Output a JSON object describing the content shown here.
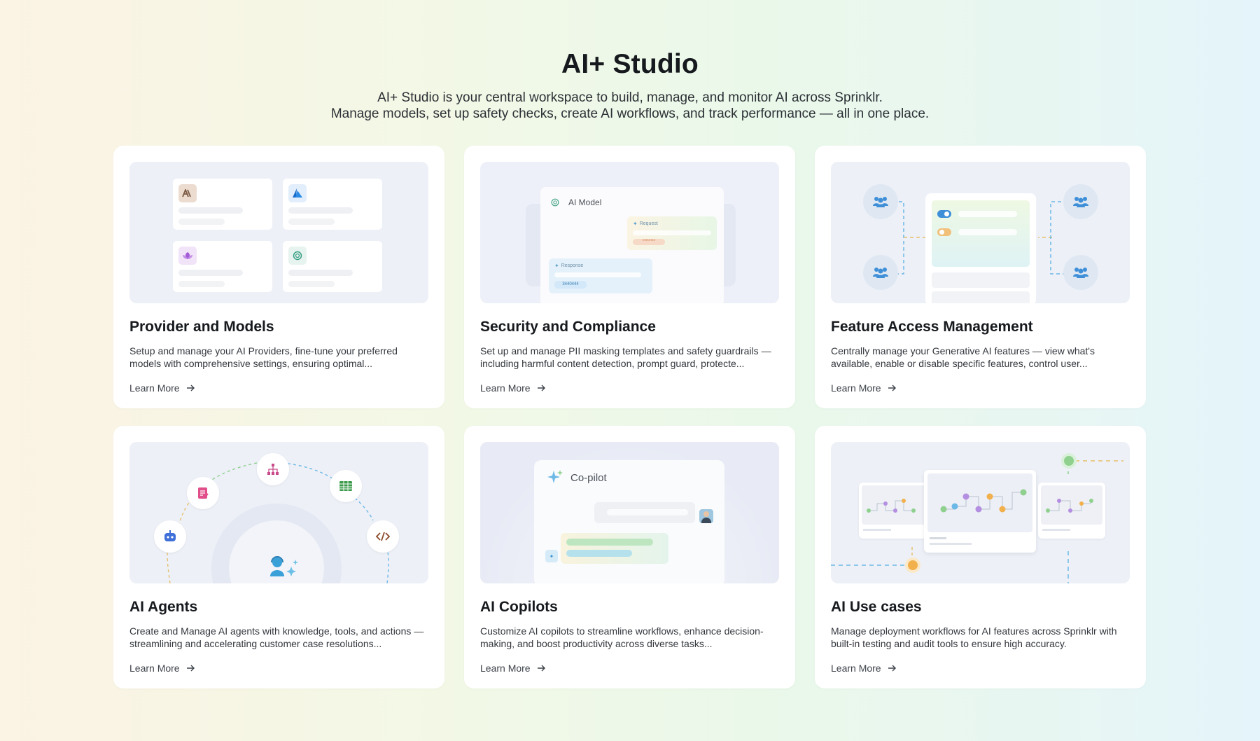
{
  "page": {
    "title": "AI+ Studio",
    "subtitle_line1": "AI+ Studio is your central workspace to build, manage, and monitor AI across Sprinklr.",
    "subtitle_line2": "Manage models, set up safety checks, create AI workflows, and track performance — all in one place."
  },
  "cards": [
    {
      "title": "Provider and Models",
      "description": "Setup and manage your AI Providers, fine-tune your preferred models with comprehensive settings, ensuring optimal...",
      "link": "Learn More",
      "illustration": {
        "icons": [
          "anthropic-logo-icon",
          "azure-logo-icon",
          "lotus-logo-icon",
          "openai-logo-icon"
        ]
      }
    },
    {
      "title": "Security and Compliance",
      "description": "Set up and manage PII masking templates and safety guardrails — including harmful content detection, prompt guard, protecte...",
      "link": "Learn More",
      "illustration": {
        "panel_title": "AI Model",
        "request_label": "Request",
        "masked_value": "********",
        "response_label": "Response",
        "response_value": "3440444"
      }
    },
    {
      "title": "Feature Access Management",
      "description": "Centrally manage your Generative AI features — view what's available, enable or disable specific features, control user...",
      "link": "Learn More",
      "illustration": {
        "toggle_1": "on",
        "toggle_2": "off"
      }
    },
    {
      "title": "AI Agents",
      "description": "Create and Manage AI agents with knowledge, tools, and actions — streamlining and accelerating customer case resolutions...",
      "link": "Learn More",
      "illustration": {
        "icons": [
          "bot-icon",
          "checklist-icon",
          "org-chart-icon",
          "spreadsheet-icon",
          "code-icon",
          "agent-support-icon"
        ]
      }
    },
    {
      "title": "AI Copilots",
      "description": "Customize AI copilots to streamline workflows, enhance decision-making, and boost productivity across diverse tasks...",
      "link": "Learn More",
      "illustration": {
        "panel_title": "Co-pilot"
      }
    },
    {
      "title": "AI Use cases",
      "description": "Manage deployment workflows for AI features across Sprinklr with built-in testing and audit tools to ensure high accuracy.",
      "link": "Learn More",
      "illustration": {
        "screens": 3
      }
    }
  ],
  "colors": {
    "accent_blue": "#3f8fd8",
    "accent_green": "#7ac77a",
    "accent_orange": "#f1b04c",
    "card_bg": "#ffffff",
    "illus_bg": "#edf0f7"
  }
}
